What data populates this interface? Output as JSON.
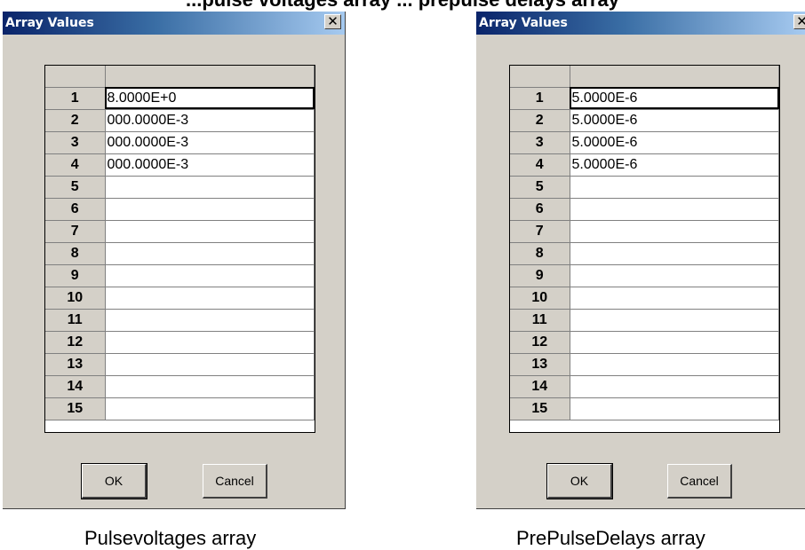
{
  "top_text": "...pulse voltages array ... prepulse delays array",
  "dialogs": [
    {
      "title": "Array Values",
      "close_glyph": "✕",
      "ok_label": "OK",
      "cancel_label": "Cancel",
      "rows": [
        {
          "n": "1",
          "v": "8.0000E+0"
        },
        {
          "n": "2",
          "v": "000.0000E-3"
        },
        {
          "n": "3",
          "v": "000.0000E-3"
        },
        {
          "n": "4",
          "v": "000.0000E-3"
        },
        {
          "n": "5",
          "v": ""
        },
        {
          "n": "6",
          "v": ""
        },
        {
          "n": "7",
          "v": ""
        },
        {
          "n": "8",
          "v": ""
        },
        {
          "n": "9",
          "v": ""
        },
        {
          "n": "10",
          "v": ""
        },
        {
          "n": "11",
          "v": ""
        },
        {
          "n": "12",
          "v": ""
        },
        {
          "n": "13",
          "v": ""
        },
        {
          "n": "14",
          "v": ""
        },
        {
          "n": "15",
          "v": ""
        }
      ],
      "caption": "Pulsevoltages array"
    },
    {
      "title": "Array Values",
      "close_glyph": "✕",
      "ok_label": "OK",
      "cancel_label": "Cancel",
      "rows": [
        {
          "n": "1",
          "v": "5.0000E-6"
        },
        {
          "n": "2",
          "v": "5.0000E-6"
        },
        {
          "n": "3",
          "v": "5.0000E-6"
        },
        {
          "n": "4",
          "v": "5.0000E-6"
        },
        {
          "n": "5",
          "v": ""
        },
        {
          "n": "6",
          "v": ""
        },
        {
          "n": "7",
          "v": ""
        },
        {
          "n": "8",
          "v": ""
        },
        {
          "n": "9",
          "v": ""
        },
        {
          "n": "10",
          "v": ""
        },
        {
          "n": "11",
          "v": ""
        },
        {
          "n": "12",
          "v": ""
        },
        {
          "n": "13",
          "v": ""
        },
        {
          "n": "14",
          "v": ""
        },
        {
          "n": "15",
          "v": ""
        }
      ],
      "caption": "PrePulseDelays array"
    }
  ],
  "colors": {
    "dialog_bg": "#d4d0c8",
    "titlebar_start": "#0a246a",
    "titlebar_end": "#a6caf0"
  }
}
